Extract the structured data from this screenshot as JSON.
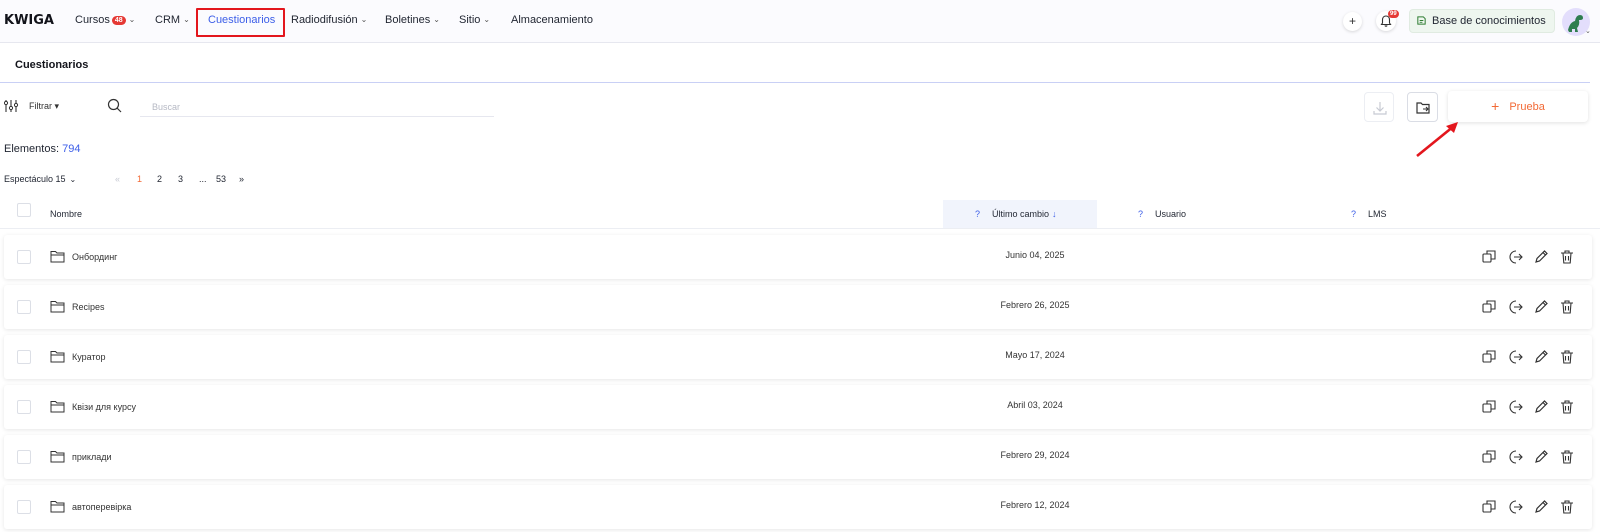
{
  "app": {
    "logo": "KWIGA"
  },
  "nav": {
    "items": [
      {
        "label": "Cursos",
        "badge": "48",
        "chev": "⌄"
      },
      {
        "label": "CRM",
        "chev": "⌄"
      },
      {
        "label": "Cuestionarios",
        "active": true
      },
      {
        "label": "Radiodifusión",
        "chev": "⌄"
      },
      {
        "label": "Boletines",
        "chev": "⌄"
      },
      {
        "label": "Sitio",
        "chev": "⌄"
      },
      {
        "label": "Almacenamiento"
      }
    ]
  },
  "header_right": {
    "plus": "+",
    "notifications_badge": "99",
    "knowledge_base": "Base de conocimientos"
  },
  "page": {
    "title": "Cuestionarios"
  },
  "toolbar": {
    "filter_label": "Filtrar",
    "search_placeholder": "Buscar",
    "create_label": "Prueba"
  },
  "summary": {
    "label": "Elementos:",
    "count": "794"
  },
  "pagination": {
    "per_page_label": "Espectáculo 15",
    "prev": "«",
    "pages": [
      "1",
      "2",
      "3",
      "...",
      "53"
    ],
    "next": "»",
    "current": "1"
  },
  "table": {
    "columns": {
      "name": "Nombre",
      "last_change": "Último cambio",
      "user": "Usuario",
      "lms": "LMS",
      "help": "?"
    },
    "rows": [
      {
        "name": "Онбординг",
        "date": "Junio 04, 2025"
      },
      {
        "name": "Recipes",
        "date": "Febrero 26, 2025"
      },
      {
        "name": "Куратор",
        "date": "Mayo 17, 2024"
      },
      {
        "name": "Квізи для курсу",
        "date": "Abril 03, 2024"
      },
      {
        "name": "приклади",
        "date": "Febrero 29, 2024"
      },
      {
        "name": "автоперевірка",
        "date": "Febrero 12, 2024"
      }
    ]
  },
  "colors": {
    "accent": "#3c5ee8",
    "create": "#f26a36",
    "highlight": "#e3161d",
    "badge": "#e53935"
  }
}
